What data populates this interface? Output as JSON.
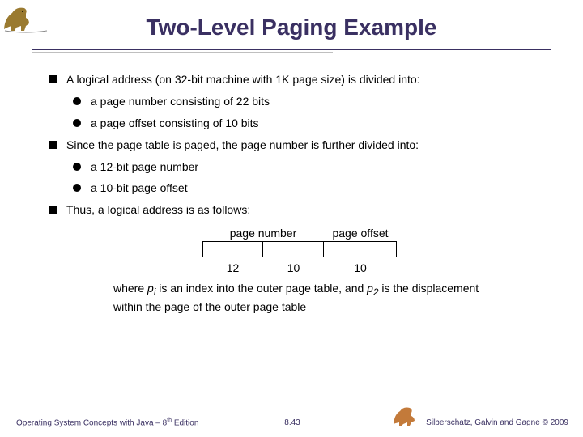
{
  "title": "Two-Level Paging Example",
  "bullets": {
    "b1": "A logical address (on 32-bit machine with 1K page size) is divided into:",
    "b1a": "a page number consisting of 22 bits",
    "b1b": "a page offset consisting of 10 bits",
    "b2": "Since the page table is paged, the page number is further divided into:",
    "b2a": "a 12-bit page number",
    "b2b": "a 10-bit page offset",
    "b3": "Thus, a logical address is as follows:"
  },
  "table": {
    "hdr_pn": "page number",
    "hdr_po": "page offset",
    "n1": "12",
    "n2": "10",
    "n3": "10"
  },
  "below_pre": "where ",
  "below_p1": "p",
  "below_i": "i",
  "below_mid1": " is an index into the outer page table, and ",
  "below_p2": "p",
  "below_2": "2",
  "below_mid2": " is the displacement within the page of the outer page table",
  "footer": {
    "left_pre": "Operating System Concepts with Java – 8",
    "left_sup": "th",
    "left_post": " Edition",
    "mid": "8.43",
    "right_pre": "Silberschatz, Galvin and Gagne ",
    "right_post": "2009",
    "copy": "©"
  }
}
